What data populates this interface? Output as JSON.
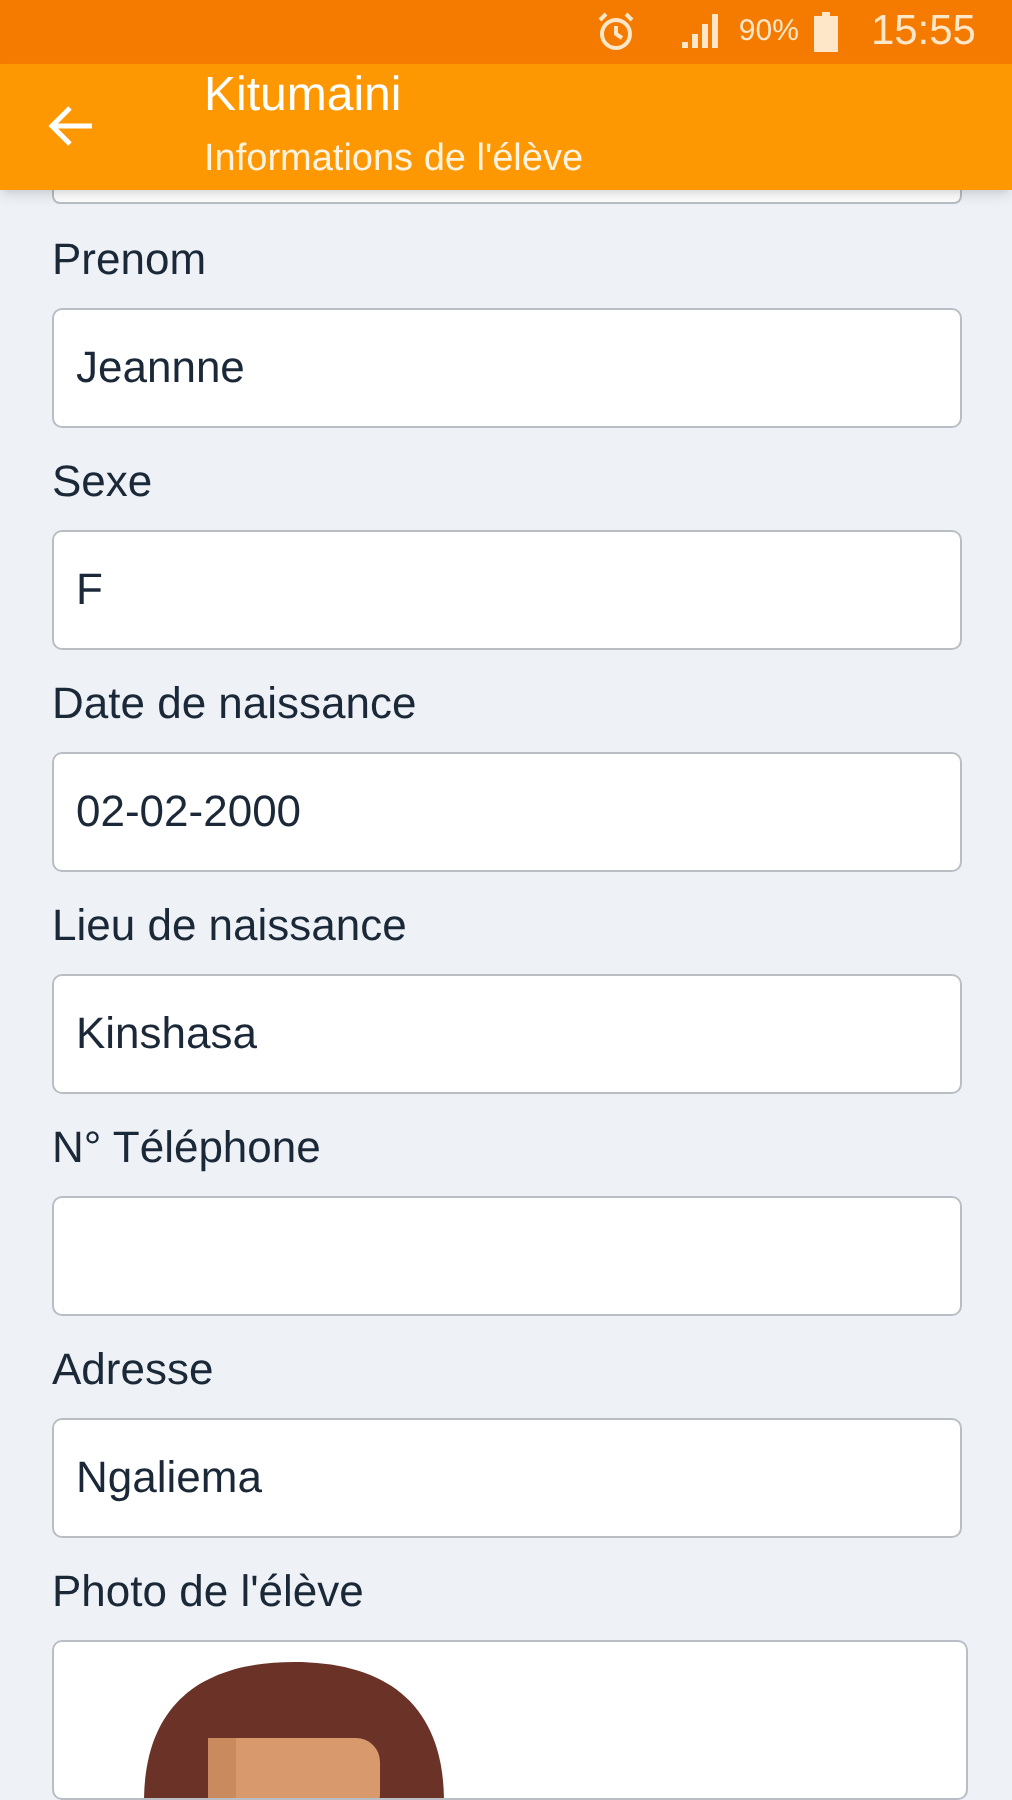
{
  "status_bar": {
    "battery": "90%",
    "time": "15:55"
  },
  "app_bar": {
    "title": "Kitumaini",
    "subtitle": "Informations de l'élève"
  },
  "fields": [
    {
      "label": "Prenom",
      "value": "Jeannne"
    },
    {
      "label": "Sexe",
      "value": "F"
    },
    {
      "label": "Date de naissance",
      "value": "02-02-2000"
    },
    {
      "label": "Lieu de naissance",
      "value": "Kinshasa"
    },
    {
      "label": "N° Téléphone"
    },
    {
      "label": "Adresse",
      "value": "Ngaliema"
    }
  ],
  "photo": {
    "label": "Photo de l'élève"
  }
}
